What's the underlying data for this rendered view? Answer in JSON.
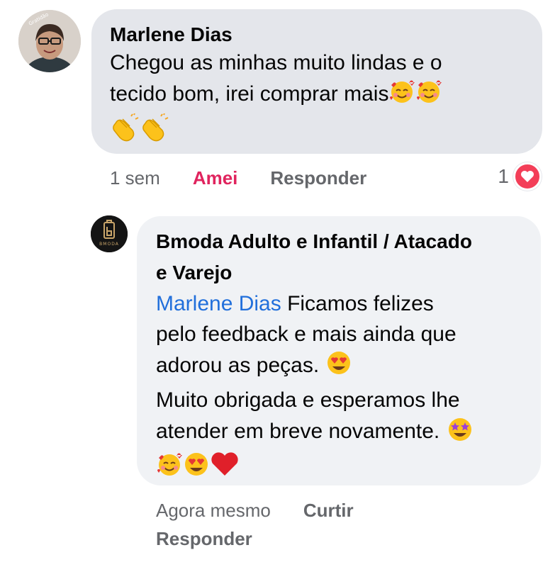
{
  "comment": {
    "author": "Marlene Dias",
    "lines": [
      "Chegou as minhas muito lindas e o",
      "tecido bom, irei comprar mais"
    ],
    "emojis_line2": [
      "smiling-face-with-hearts",
      "smiling-face-with-hearts"
    ],
    "emojis_line3": [
      "clapping-hands",
      "clapping-hands"
    ],
    "avatar_badge": "Gratidão",
    "time": "1 sem",
    "reaction_action": "Amei",
    "reply_action": "Responder",
    "reaction_count": "1"
  },
  "reply": {
    "author_line1": "Bmoda Adulto e Infantil / Atacado",
    "author_line2": "e Varejo",
    "mention": "Marlene Dias",
    "line1_rest": " Ficamos felizes",
    "line2": "pelo feedback e mais ainda que",
    "line3": "adorou as peças. ",
    "line4": "Muito obrigada e esperamos lhe",
    "line5": "atender em breve novamente. ",
    "avatar_text": "BMODA",
    "time": "Agora mesmo",
    "like_action": "Curtir",
    "reply_action": "Responder"
  },
  "colors": {
    "bubble_primary": "#e4e6eb",
    "bubble_reply": "#f0f2f5",
    "love_red": "#e0245e",
    "mention_blue": "#216fdb",
    "meta_gray": "#65676b"
  }
}
